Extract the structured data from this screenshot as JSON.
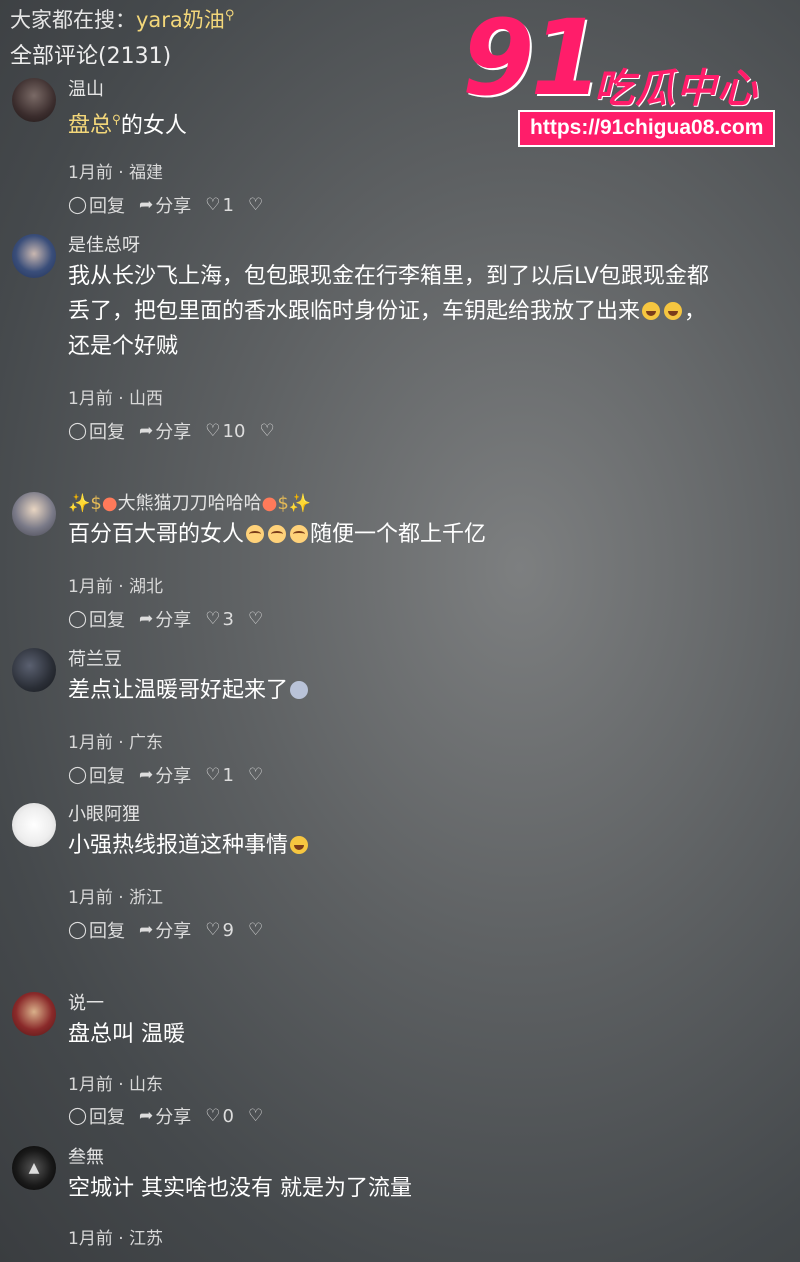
{
  "top": {
    "search_prefix": "大家都在搜：",
    "search_keyword": "yara奶油",
    "magnifier_glyph": "⚲",
    "all_comments": "全部评论(2131)"
  },
  "logo": {
    "number": "91",
    "brand": "吃瓜中心",
    "url": "https://91chigua08.com"
  },
  "actions": {
    "reply": "回复",
    "share": "分享"
  },
  "comments": [
    {
      "username": "温山",
      "highlight": "盘总",
      "text_after": "的女人",
      "time": "1月前",
      "location": "福建",
      "likes": "1",
      "avatar_color": "#3b2d2d"
    },
    {
      "username": "是佳总呀",
      "text_line1": "我从长沙飞上海，包包跟现金在行李箱里，到了以后LV包跟现金都",
      "text_line2": "丢了，把包里面的香水跟临时身份证，车钥匙给我放了出来",
      "text_line2_tail": "，",
      "text_line3": "还是个好贼",
      "time": "1月前",
      "location": "山西",
      "likes": "10",
      "avatar_color": "#2f3f66"
    },
    {
      "username_core": "大熊猫刀刀哈哈哈",
      "text_before": "百分百大哥的女人",
      "text_after": "随便一个都上千亿",
      "time": "1月前",
      "location": "湖北",
      "likes": "3",
      "avatar_color": "#6b6b7a"
    },
    {
      "username": "荷兰豆",
      "text": "差点让温暖哥好起来了",
      "time": "1月前",
      "location": "广东",
      "likes": "1",
      "avatar_color": "#2a2e36"
    },
    {
      "username": "小眼阿狸",
      "text": "小强热线报道这种事情",
      "time": "1月前",
      "location": "浙江",
      "likes": "9",
      "avatar_color": "#f2f2f2"
    },
    {
      "username": "说一",
      "text": "盘总叫 温暖",
      "time": "1月前",
      "location": "山东",
      "likes": "0",
      "avatar_color": "#8a2a2a"
    },
    {
      "username": "叁無",
      "text": "空城计 其实啥也没有 就是为了流量",
      "time": "1月前",
      "location": "江苏",
      "avatar_color": "#1a1a1a"
    }
  ],
  "meta_separator": " · "
}
